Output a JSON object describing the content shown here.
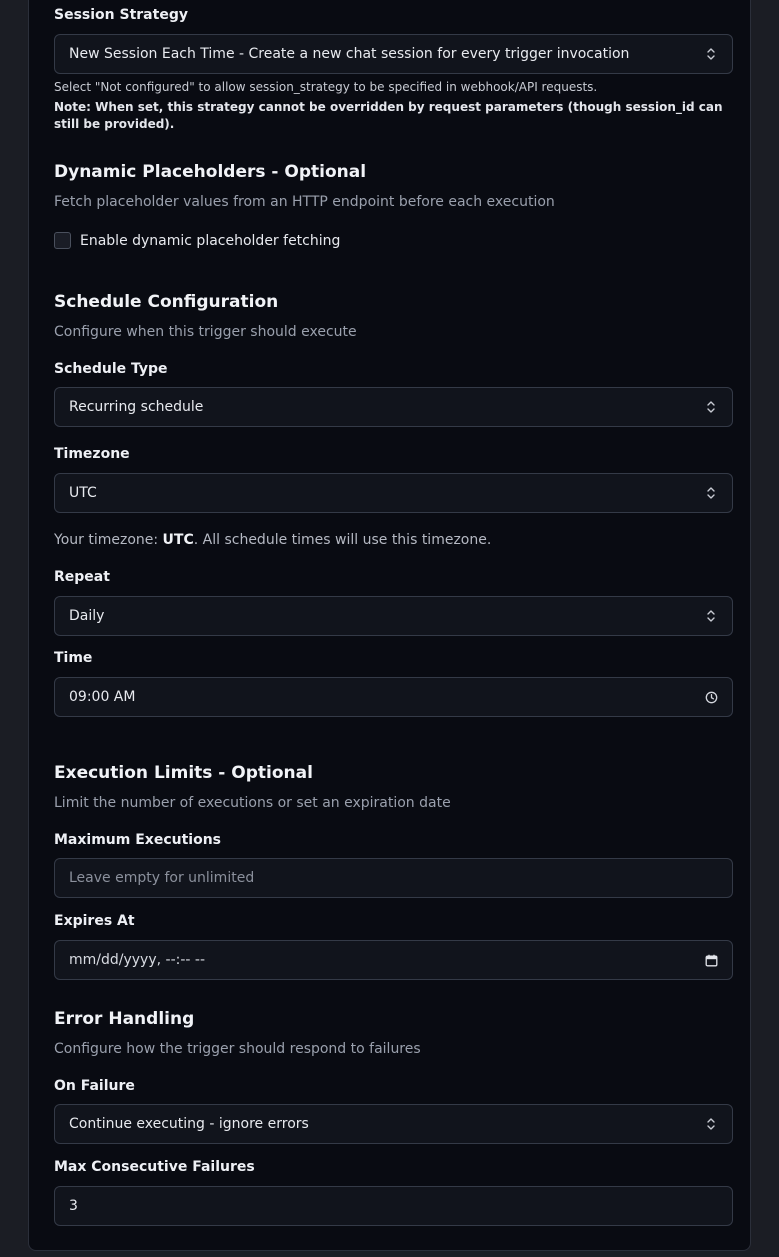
{
  "session": {
    "label": "Session Strategy",
    "value": "New Session Each Time - Create a new chat session for every trigger invocation",
    "help": "Select \"Not configured\" to allow session_strategy to be specified in webhook/API requests.",
    "note": "Note: When set, this strategy cannot be overridden by request parameters (though session_id can still be provided)."
  },
  "dynamic": {
    "title": "Dynamic Placeholders - Optional",
    "desc": "Fetch placeholder values from an HTTP endpoint before each execution",
    "checkbox_label": "Enable dynamic placeholder fetching",
    "checked": false
  },
  "schedule": {
    "title": "Schedule Configuration",
    "desc": "Configure when this trigger should execute",
    "type_label": "Schedule Type",
    "type_value": "Recurring schedule",
    "tz_label": "Timezone",
    "tz_value": "UTC",
    "tz_help_prefix": "Your timezone: ",
    "tz_help_value": "UTC",
    "tz_help_suffix": ". All schedule times will use this timezone.",
    "repeat_label": "Repeat",
    "repeat_value": "Daily",
    "time_label": "Time",
    "time_value": "09:00 AM"
  },
  "limits": {
    "title": "Execution Limits - Optional",
    "desc": "Limit the number of executions or set an expiration date",
    "max_label": "Maximum Executions",
    "max_placeholder": "Leave empty for unlimited",
    "expires_label": "Expires At",
    "expires_placeholder": "mm/dd/yyyy, --:-- --"
  },
  "errors": {
    "title": "Error Handling",
    "desc": "Configure how the trigger should respond to failures",
    "onfail_label": "On Failure",
    "onfail_value": "Continue executing - ignore errors",
    "maxfail_label": "Max Consecutive Failures",
    "maxfail_value": "3"
  },
  "icons": {
    "select": "chevron-up-down-icon",
    "time": "clock-icon",
    "date": "calendar-icon"
  }
}
